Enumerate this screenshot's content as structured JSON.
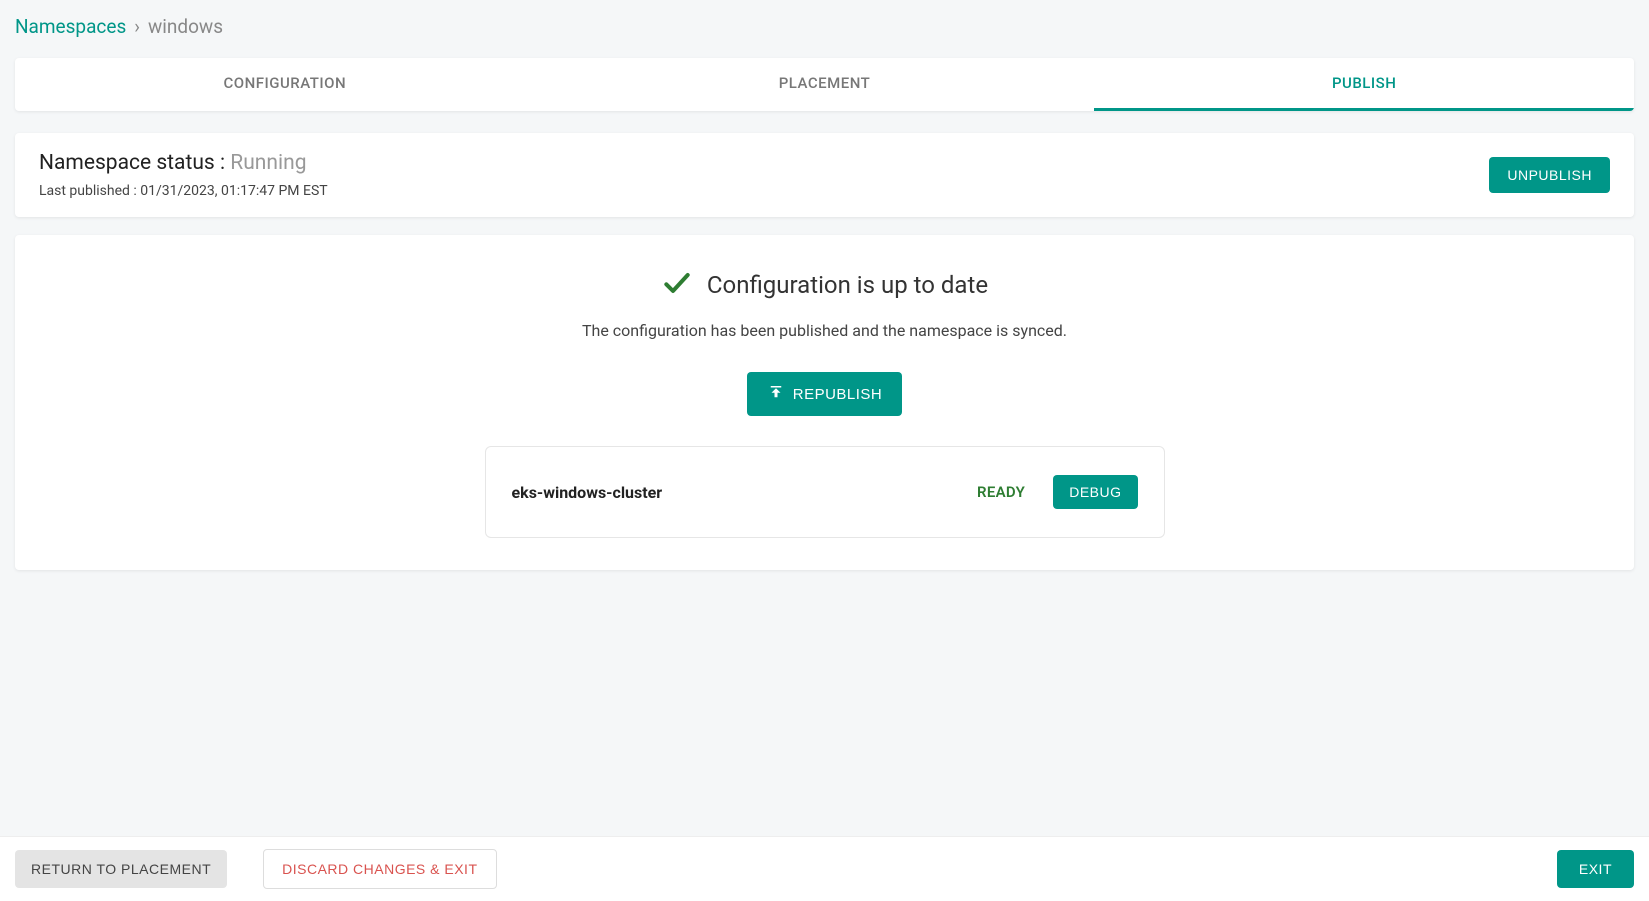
{
  "breadcrumb": {
    "root": "Namespaces",
    "separator": "›",
    "current": "windows"
  },
  "tabs": {
    "configuration": "CONFIGURATION",
    "placement": "PLACEMENT",
    "publish": "PUBLISH"
  },
  "status_card": {
    "title_label": "Namespace status : ",
    "status_value": "Running",
    "last_published_prefix": "Last published : ",
    "last_published_value": "01/31/2023, 01:17:47 PM EST",
    "unpublish_label": "UNPUBLISH"
  },
  "main": {
    "up_to_date_title": "Configuration is up to date",
    "up_to_date_subtitle": "The configuration has been published and the namespace is synced.",
    "republish_label": "REPUBLISH"
  },
  "cluster": {
    "name": "eks-windows-cluster",
    "status": "READY",
    "debug_label": "DEBUG"
  },
  "footer": {
    "return_label": "RETURN TO PLACEMENT",
    "discard_label": "DISCARD CHANGES & EXIT",
    "exit_label": "EXIT"
  },
  "colors": {
    "primary": "#009688",
    "success": "#2e7d32",
    "danger": "#d9534f"
  }
}
